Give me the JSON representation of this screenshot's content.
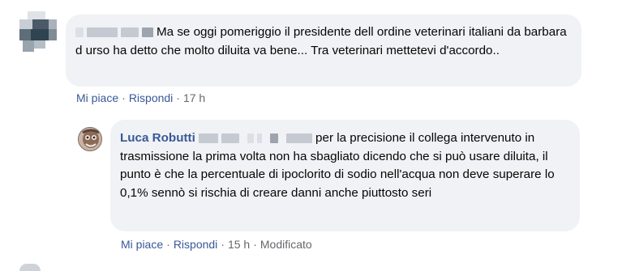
{
  "comment1": {
    "text": "Ma se oggi pomeriggio il presidente dell ordine veterinari italiani da barbara d urso ha detto che molto diluita va bene... Tra veterinari mettetevi d'accordo..",
    "like_label": "Mi piace",
    "reply_label": "Rispondi",
    "time": "17 h"
  },
  "comment2": {
    "author": "Luca Robutti",
    "text": "per la precisione il collega intervenuto in trasmissione la prima volta non ha sbagliato dicendo che si può usare diluita, il punto è che la percentuale di ipoclorito di sodio nell'acqua non deve superare lo 0,1% sennò si rischia di creare danni anche piuttosto seri",
    "like_label": "Mi piace",
    "reply_label": "Rispondi",
    "time": "15 h",
    "edited_label": "Modificato"
  },
  "colors": {
    "bubble": "#f0f2f5",
    "link": "#385898",
    "meta": "#65676b"
  }
}
